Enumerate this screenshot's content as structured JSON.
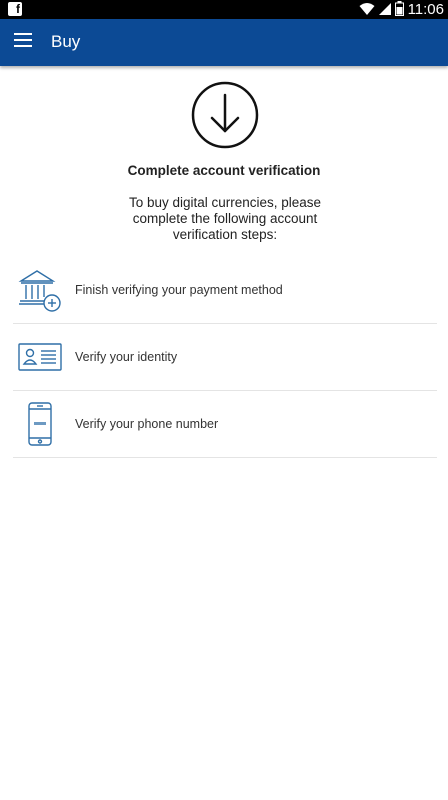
{
  "status_bar": {
    "time": "11:06",
    "icons": [
      "facebook-icon",
      "wifi-icon",
      "signal-icon",
      "battery-icon"
    ]
  },
  "app_bar": {
    "title": "Buy",
    "menu_icon": "menu-icon",
    "background": "#0c4a95"
  },
  "main": {
    "hero_icon": "download-circle-icon",
    "heading": "Complete account verification",
    "description": "To buy digital currencies, please complete the following account verification steps:",
    "steps": [
      {
        "label": "Finish verifying your payment method",
        "icon": "bank-add-icon"
      },
      {
        "label": "Verify your identity",
        "icon": "id-card-icon"
      },
      {
        "label": "Verify your phone number",
        "icon": "phone-icon"
      }
    ]
  },
  "colors": {
    "accent": "#0c4a95",
    "icon_stroke": "#2f6fa7",
    "text": "#222222"
  }
}
